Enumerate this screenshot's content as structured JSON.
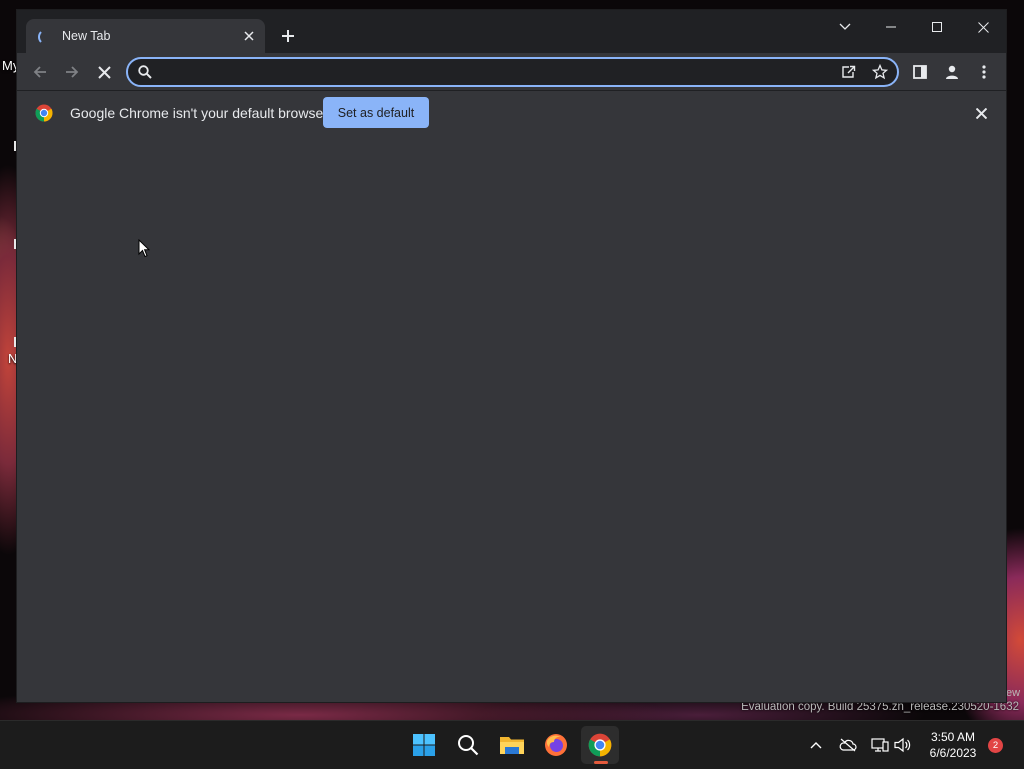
{
  "desktop": {
    "labels": [
      "My",
      "N"
    ],
    "watermark": "Evaluation copy. Build 25375.zn_release.230520-1632",
    "watermark_fragment": "ew"
  },
  "browser": {
    "tab": {
      "title": "New Tab",
      "loading": true
    },
    "window_controls": [
      "tab-search",
      "minimize",
      "maximize",
      "close"
    ],
    "toolbar": {
      "back_enabled": false,
      "forward_enabled": false,
      "reload_state": "stop",
      "omnibox": {
        "value": "",
        "placeholder": "",
        "focused": true
      }
    },
    "infobar": {
      "message": "Google Chrome isn't your default browser",
      "button_label": "Set as default"
    },
    "colors": {
      "frame": "#202124",
      "toolbar": "#35363a",
      "accent": "#8ab4f8",
      "text": "#e8eaed"
    }
  },
  "taskbar": {
    "apps": [
      "start-icon",
      "search-icon",
      "file-explorer-icon",
      "firefox-icon",
      "chrome-icon"
    ],
    "active_app": "chrome",
    "tray_icons": [
      "chevron-up-icon",
      "onedrive-offline-icon",
      "network-icon",
      "volume-icon"
    ],
    "clock": {
      "time": "3:50 AM",
      "date": "6/6/2023"
    },
    "notification_count": "2"
  }
}
